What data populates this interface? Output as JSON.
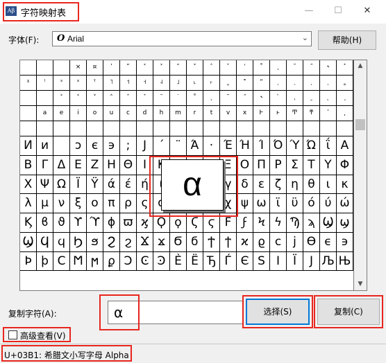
{
  "window": {
    "title": "字符映射表",
    "icon": "charmap-app-icon",
    "minimize_glyph": "—",
    "maximize_glyph": "☐",
    "close_glyph": "✕"
  },
  "font": {
    "label": "字体(F):",
    "value": "Arial",
    "type_glyph": "O",
    "help_button": "帮助(H)"
  },
  "grid": {
    "columns": 20,
    "rows": [
      [
        "",
        "",
        "",
        "",
        "",
        "",
        "",
        "",
        "",
        "",
        "",
        "",
        "",
        "",
        "",
        "",
        "",
        "",
        "",
        ""
      ],
      [
        "",
        "",
        "",
        "",
        "",
        "",
        "",
        "",
        "",
        "",
        "",
        "",
        "",
        "",
        "",
        "",
        "",
        "",
        "",
        ""
      ],
      [
        "",
        "",
        "",
        "",
        "",
        "",
        "",
        "",
        "",
        "",
        "",
        "",
        "",
        "",
        "",
        "",
        "",
        "",
        "",
        ""
      ],
      [
        "",
        "",
        "",
        "",
        "",
        "",
        "",
        "",
        "",
        "",
        "",
        "",
        "",
        "",
        "",
        "",
        "",
        "",
        "",
        ""
      ],
      [
        "",
        "",
        "",
        "",
        "",
        "",
        "",
        "",
        "",
        "",
        "",
        "",
        "",
        "",
        "",
        "",
        "",
        "",
        "",
        ""
      ],
      [
        "И",
        "и",
        "",
        "ɔ",
        "є",
        "϶",
        ";",
        "J",
        "´",
        "¨",
        "Ά",
        "·",
        "Έ",
        "Ή",
        "Ί",
        "Ό",
        "Ύ",
        "Ώ",
        "ΐ",
        "Α"
      ],
      [
        "Β",
        "Γ",
        "Δ",
        "Ε",
        "Ζ",
        "Η",
        "Θ",
        "Ι",
        "Κ",
        "Λ",
        "Μ",
        "Ν",
        "Ξ",
        "Ο",
        "Π",
        "Ρ",
        "Σ",
        "Τ",
        "Υ",
        "Φ"
      ],
      [
        "Χ",
        "Ψ",
        "Ω",
        "Ϊ",
        "Ϋ",
        "ά",
        "έ",
        "ή",
        "ί",
        "ΰ",
        "α",
        "β",
        "γ",
        "δ",
        "ε",
        "ζ",
        "η",
        "θ",
        "ι",
        "κ"
      ],
      [
        "λ",
        "μ",
        "ν",
        "ξ",
        "ο",
        "π",
        "ρ",
        "ς",
        "σ",
        "τ",
        "υ",
        "φ",
        "χ",
        "ψ",
        "ω",
        "ϊ",
        "ϋ",
        "ό",
        "ύ",
        "ώ"
      ],
      [
        "Ϗ",
        "ϐ",
        "ϑ",
        "ϒ",
        "ϓ",
        "ϕ",
        "ϖ",
        "ϗ",
        "Ϙ",
        "ϙ",
        "Ϛ",
        "ϛ",
        "Ϝ",
        "ϝ",
        "Ϟ",
        "ϟ",
        "Ϡ",
        "ϡ",
        "Ϣ",
        "ϣ"
      ],
      [
        "Ϣ",
        "Ϥ",
        "ϥ",
        "Ϧ",
        "ϧ",
        "Ϩ",
        "ϩ",
        "Ϫ",
        "ϫ",
        "Ϭ",
        "ϭ",
        "Ϯ",
        "ϯ",
        "ϰ",
        "ϱ",
        "ϲ",
        "ϳ",
        "ϴ",
        "ϵ",
        "϶"
      ],
      [
        "Ϸ",
        "ϸ",
        "Ϲ",
        "Ϻ",
        "ϻ",
        "ϼ",
        "Ͻ",
        "Ͼ",
        "Ͽ",
        "Ѐ",
        "Ё",
        "Ђ",
        "Ѓ",
        "Є",
        "Ѕ",
        "І",
        "Ї",
        "Ј",
        "Љ",
        "Њ"
      ]
    ],
    "row_labels": [
      "row-1",
      "row-2",
      "row-3",
      "row-4",
      "row-5"
    ],
    "small_rows": [
      [
        "",
        "",
        "",
        "×",
        "¤",
        "ʹ",
        "ʺ",
        "˂",
        "˃",
        "˄",
        "˅",
        "ˆ",
        "ˇ",
        "ˈ",
        "˚",
        "˛",
        "˜",
        "˝",
        "˞",
        "˟"
      ],
      [
        "ˠ",
        "ˡ",
        "ˢ",
        "ˣ",
        "ˤ",
        "˥",
        "˦",
        "˧",
        "˨",
        "˩",
        "˪",
        "˫",
        "ˬ",
        "˭",
        "ˮ",
        "˯",
        "˰",
        "˱",
        "˲",
        "˳"
      ],
      [
        "",
        "",
        "˃",
        "˂",
        "˅",
        "˄",
        "ˆ",
        "ˇ",
        "˘",
        "˙",
        "˚",
        "˛",
        "˜",
        "˝",
        "˞",
        "ˋ",
        "ˌ",
        "ˍ",
        "ˎ",
        "ˏ"
      ],
      [
        "",
        "a",
        "e",
        "i",
        "o",
        "u",
        "c",
        "d",
        "h",
        "m",
        "r",
        "t",
        "v",
        "x",
        "Ͱ",
        "ͱ",
        "Ͳ",
        "ͳ",
        "ʹ",
        "͵"
      ],
      [
        "",
        "",
        "",
        "",
        "",
        "",
        "",
        "",
        "",
        "",
        "",
        "",
        "",
        "",
        "",
        "",
        "",
        "",
        "",
        ""
      ]
    ],
    "selected_char": "α"
  },
  "copy": {
    "label": "复制字符(A):",
    "value": "α",
    "select_button": "选择(S)",
    "copy_button": "复制(C)"
  },
  "advanced": {
    "label": "高级查看(V)",
    "checked": false
  },
  "status": {
    "text": "U+03B1: 希腊文小写字母 Alpha"
  },
  "accent_colors": {
    "annotation_red": "#e8251d",
    "button_blue": "#0078d7"
  }
}
